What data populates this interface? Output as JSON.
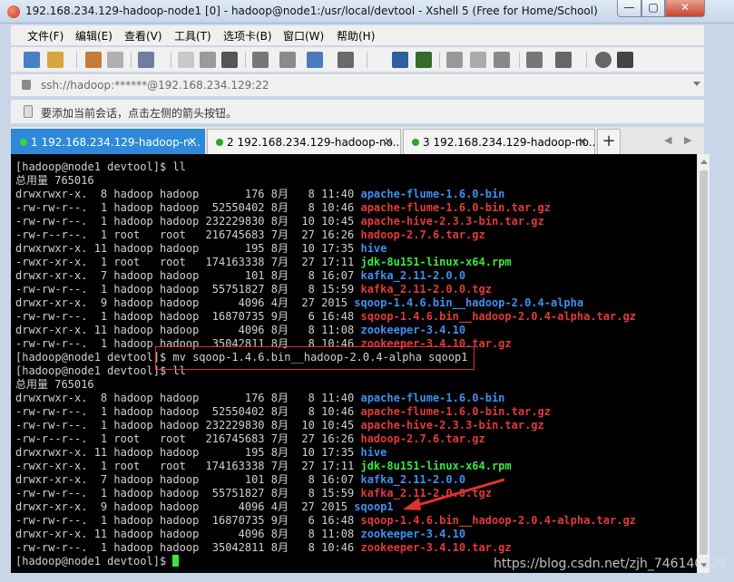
{
  "window": {
    "title": "192.168.234.129-hadoop-node1 [0] - hadoop@node1:/usr/local/devtool - Xshell 5 (Free for Home/School)",
    "min_label": "—",
    "max_label": "▢",
    "close_label": "✕"
  },
  "menu": [
    "文件(F)",
    "编辑(E)",
    "查看(V)",
    "工具(T)",
    "选项卡(B)",
    "窗口(W)",
    "帮助(H)"
  ],
  "address": "ssh://hadoop:******@192.168.234.129:22",
  "hint": "要添加当前会话，点击左侧的箭头按钮。",
  "tabs": [
    {
      "label": "1 192.168.234.129-hadoop-n...",
      "active": true
    },
    {
      "label": "2 192.168.234.129-hadoop-no...",
      "active": false
    },
    {
      "label": "3 192.168.234.129-hadoop-no...",
      "active": false
    }
  ],
  "tab_add_label": "+",
  "terminal": {
    "lines": [
      {
        "meta": "[hadoop@node1 devtool]$ ll",
        "name": "",
        "color": ""
      },
      {
        "meta": "总用量 765016",
        "name": "",
        "color": ""
      },
      {
        "meta": "drwxrwxr-x.  8 hadoop hadoop       176 8月   8 11:40 ",
        "name": "apache-flume-1.6.0-bin",
        "color": "dir"
      },
      {
        "meta": "-rw-rw-r--.  1 hadoop hadoop  52550402 8月   8 10:46 ",
        "name": "apache-flume-1.6.0-bin.tar.gz",
        "color": "arch"
      },
      {
        "meta": "-rw-rw-r--.  1 hadoop hadoop 232229830 8月  10 10:45 ",
        "name": "apache-hive-2.3.3-bin.tar.gz",
        "color": "arch"
      },
      {
        "meta": "-rw-r--r--.  1 root   root   216745683 7月  27 16:26 ",
        "name": "hadoop-2.7.6.tar.gz",
        "color": "arch"
      },
      {
        "meta": "drwxrwxr-x. 11 hadoop hadoop       195 8月  10 17:35 ",
        "name": "hive",
        "color": "dir"
      },
      {
        "meta": "-rwxr-xr-x.  1 root   root   174163338 7月  27 17:11 ",
        "name": "jdk-8u151-linux-x64.rpm",
        "color": "exec"
      },
      {
        "meta": "drwxr-xr-x.  7 hadoop hadoop       101 8月   8 16:07 ",
        "name": "kafka_2.11-2.0.0",
        "color": "dir"
      },
      {
        "meta": "-rw-rw-r--.  1 hadoop hadoop  55751827 8月   8 15:59 ",
        "name": "kafka_2.11-2.0.0.tgz",
        "color": "arch"
      },
      {
        "meta": "drwxr-xr-x.  9 hadoop hadoop      4096 4月  27 2015 ",
        "name": "sqoop-1.4.6.bin__hadoop-2.0.4-alpha",
        "color": "dir"
      },
      {
        "meta": "-rw-rw-r--.  1 hadoop hadoop  16870735 9月   6 16:48 ",
        "name": "sqoop-1.4.6.bin__hadoop-2.0.4-alpha.tar.gz",
        "color": "arch"
      },
      {
        "meta": "drwxr-xr-x. 11 hadoop hadoop      4096 8月   8 11:08 ",
        "name": "zookeeper-3.4.10",
        "color": "dir"
      },
      {
        "meta": "-rw-rw-r--.  1 hadoop hadoop  35042811 8月   8 10:46 ",
        "name": "zookeeper-3.4.10.tar.gz",
        "color": "arch"
      },
      {
        "meta": "[hadoop@node1 devtool]$ mv sqoop-1.4.6.bin__hadoop-2.0.4-alpha sqoop1",
        "name": "",
        "color": ""
      },
      {
        "meta": "[hadoop@node1 devtool]$ ll",
        "name": "",
        "color": ""
      },
      {
        "meta": "总用量 765016",
        "name": "",
        "color": ""
      },
      {
        "meta": "drwxrwxr-x.  8 hadoop hadoop       176 8月   8 11:40 ",
        "name": "apache-flume-1.6.0-bin",
        "color": "dir"
      },
      {
        "meta": "-rw-rw-r--.  1 hadoop hadoop  52550402 8月   8 10:46 ",
        "name": "apache-flume-1.6.0-bin.tar.gz",
        "color": "arch"
      },
      {
        "meta": "-rw-rw-r--.  1 hadoop hadoop 232229830 8月  10 10:45 ",
        "name": "apache-hive-2.3.3-bin.tar.gz",
        "color": "arch"
      },
      {
        "meta": "-rw-r--r--.  1 root   root   216745683 7月  27 16:26 ",
        "name": "hadoop-2.7.6.tar.gz",
        "color": "arch"
      },
      {
        "meta": "drwxrwxr-x. 11 hadoop hadoop       195 8月  10 17:35 ",
        "name": "hive",
        "color": "dir"
      },
      {
        "meta": "-rwxr-xr-x.  1 root   root   174163338 7月  27 17:11 ",
        "name": "jdk-8u151-linux-x64.rpm",
        "color": "exec"
      },
      {
        "meta": "drwxr-xr-x.  7 hadoop hadoop       101 8月   8 16:07 ",
        "name": "kafka_2.11-2.0.0",
        "color": "dir"
      },
      {
        "meta": "-rw-rw-r--.  1 hadoop hadoop  55751827 8月   8 15:59 ",
        "name": "kafka_2.11-2.0.0.tgz",
        "color": "arch"
      },
      {
        "meta": "drwxr-xr-x.  9 hadoop hadoop      4096 4月  27 2015 ",
        "name": "sqoop1",
        "color": "dir"
      },
      {
        "meta": "-rw-rw-r--.  1 hadoop hadoop  16870735 9月   6 16:48 ",
        "name": "sqoop-1.4.6.bin__hadoop-2.0.4-alpha.tar.gz",
        "color": "arch"
      },
      {
        "meta": "drwxr-xr-x. 11 hadoop hadoop      4096 8月   8 11:08 ",
        "name": "zookeeper-3.4.10",
        "color": "dir"
      },
      {
        "meta": "-rw-rw-r--.  1 hadoop hadoop  35042811 8月   8 10:46 ",
        "name": "zookeeper-3.4.10.tar.gz",
        "color": "arch"
      },
      {
        "meta": "[hadoop@node1 devtool]$ ",
        "name": "",
        "color": "",
        "cursor": true
      }
    ]
  },
  "watermark": "https://blog.csdn.net/zjh_746140129",
  "colors": {
    "dir": "#3f8ff0",
    "exec": "#3be83b",
    "arch": "#e23a3a",
    "tab_active": "#2e8ad8",
    "annotation": "#e03030"
  }
}
